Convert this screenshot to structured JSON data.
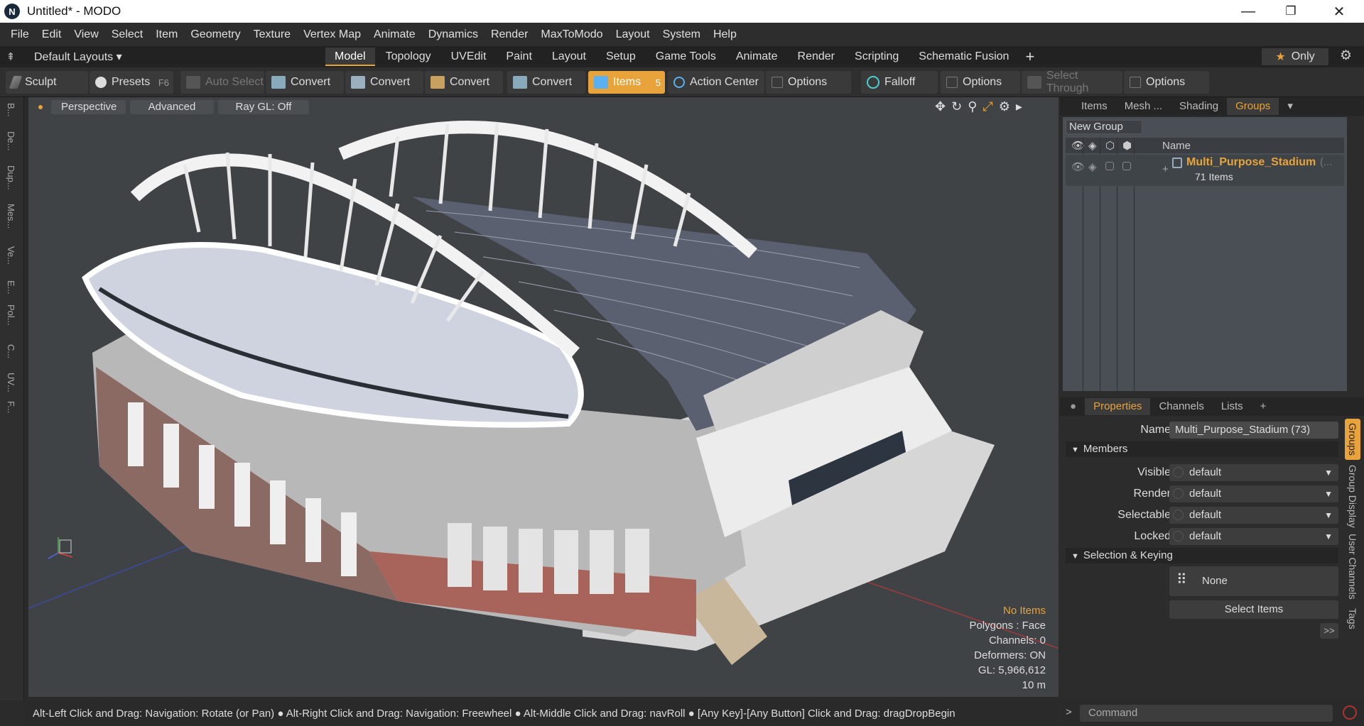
{
  "window": {
    "title": "Untitled* - MODO",
    "minimize": "—",
    "maximize": "❐",
    "close": "✕"
  },
  "menu": [
    "File",
    "Edit",
    "View",
    "Select",
    "Item",
    "Geometry",
    "Texture",
    "Vertex Map",
    "Animate",
    "Dynamics",
    "Render",
    "MaxToModo",
    "Layout",
    "System",
    "Help"
  ],
  "layouts": {
    "label": "Default Layouts ▾"
  },
  "tabs": [
    {
      "label": "Model",
      "active": true
    },
    {
      "label": "Topology"
    },
    {
      "label": "UVEdit"
    },
    {
      "label": "Paint"
    },
    {
      "label": "Layout"
    },
    {
      "label": "Setup"
    },
    {
      "label": "Game Tools"
    },
    {
      "label": "Animate"
    },
    {
      "label": "Render"
    },
    {
      "label": "Scripting"
    },
    {
      "label": "Schematic Fusion"
    }
  ],
  "only_label": "Only",
  "toolbar": {
    "sculpt": "Sculpt",
    "presets": "Presets",
    "presets_key": "F6",
    "auto_select": "Auto Select",
    "convert1": "Convert",
    "convert2": "Convert",
    "convert3": "Convert",
    "convert4": "Convert",
    "items": "Items",
    "items_key": "5",
    "action_center": "Action Center",
    "options1": "Options",
    "falloff": "Falloff",
    "options2": "Options",
    "select_through": "Select Through",
    "options3": "Options"
  },
  "lefttools": [
    "B...",
    "De...",
    "Dup...",
    "Mes...",
    "Ve...",
    "E...",
    "Pol...",
    "C...",
    "UV...",
    "F..."
  ],
  "viewport": {
    "perspective": "Perspective",
    "advanced": "Advanced",
    "raygl": "Ray GL: Off",
    "info": {
      "no_items": "No Items",
      "polygons": "Polygons : Face",
      "channels": "Channels: 0",
      "deformers": "Deformers: ON",
      "gl": "GL: 5,966,612",
      "scale": "10 m"
    }
  },
  "status": "Alt-Left Click and Drag: Navigation: Rotate (or Pan) ● Alt-Right Click and Drag: Navigation: Freewheel ● Alt-Middle Click and Drag: navRoll ● [Any Key]-[Any Button] Click and Drag: dragDropBegin",
  "top_panel": {
    "tabs": [
      "Items",
      "Mesh ...",
      "Shading",
      "Groups"
    ],
    "new_group": "New Group",
    "col_name": "Name",
    "group_name": "Multi_Purpose_Stadium",
    "group_suffix": "(...",
    "group_items": "71 Items"
  },
  "bottom_panel": {
    "tabs": [
      "Properties",
      "Channels",
      "Lists"
    ],
    "name_label": "Name",
    "name_value": "Multi_Purpose_Stadium (73)",
    "members": "Members",
    "visible_label": "Visible",
    "visible_value": "default",
    "render_label": "Render",
    "render_value": "default",
    "selectable_label": "Selectable",
    "selectable_value": "default",
    "locked_label": "Locked",
    "locked_value": "default",
    "selection_keying": "Selection & Keying",
    "none": "None",
    "select_items": "Select Items",
    "more": ">>"
  },
  "side_tabs": [
    "Groups",
    "Group Display",
    "User Channels",
    "Tags"
  ],
  "command_placeholder": "Command",
  "colors": {
    "accent": "#e8a33a",
    "viewport": "#404346"
  }
}
